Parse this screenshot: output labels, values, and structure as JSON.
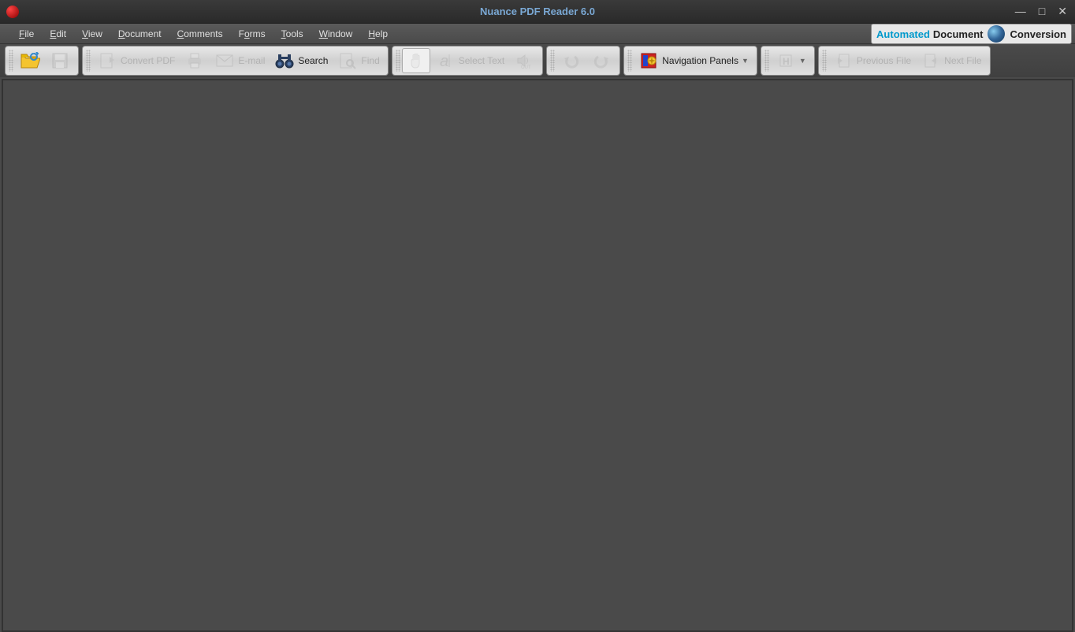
{
  "app": {
    "title": "Nuance PDF Reader 6.0"
  },
  "menubar": {
    "items": [
      {
        "label": "File",
        "accel": "F"
      },
      {
        "label": "Edit",
        "accel": "E"
      },
      {
        "label": "View",
        "accel": "V"
      },
      {
        "label": "Document",
        "accel": "D"
      },
      {
        "label": "Comments",
        "accel": "C"
      },
      {
        "label": "Forms",
        "accel": "o"
      },
      {
        "label": "Tools",
        "accel": "T"
      },
      {
        "label": "Window",
        "accel": "W"
      },
      {
        "label": "Help",
        "accel": "H"
      }
    ]
  },
  "branding": {
    "automated": "Automated",
    "document": "Document",
    "conversion": "Conversion"
  },
  "toolbar": {
    "open": "",
    "save": "",
    "convert": "Convert PDF",
    "print": "",
    "email": "E-mail",
    "search": "Search",
    "find": "Find",
    "hand": "",
    "select_text": "Select Text",
    "read_aloud": "",
    "undo": "",
    "redo": "",
    "nav_panels": "Navigation Panels",
    "highlight": "",
    "prev_file": "Previous File",
    "next_file": "Next File"
  }
}
